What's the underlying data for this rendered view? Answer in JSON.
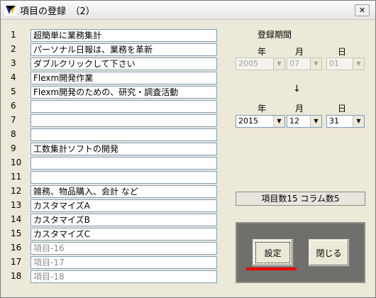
{
  "window": {
    "title": "項目の登録　（2）",
    "close_icon": "close-icon",
    "app_icon": "app-icon"
  },
  "rows": [
    {
      "num": "1",
      "text": "超簡単に業務集計",
      "placeholder": false
    },
    {
      "num": "2",
      "text": "パーソナル日報は、業務を革新",
      "placeholder": false
    },
    {
      "num": "3",
      "text": "ダブルクリックして下さい",
      "placeholder": false
    },
    {
      "num": "4",
      "text": "Flexm開発作業",
      "placeholder": false
    },
    {
      "num": "5",
      "text": "Flexm開発のための、研究・調査活動",
      "placeholder": false
    },
    {
      "num": "6",
      "text": "",
      "placeholder": false
    },
    {
      "num": "7",
      "text": "",
      "placeholder": false
    },
    {
      "num": "8",
      "text": "",
      "placeholder": false
    },
    {
      "num": "9",
      "text": "工数集計ソフトの開発",
      "placeholder": false
    },
    {
      "num": "10",
      "text": "",
      "placeholder": false
    },
    {
      "num": "11",
      "text": "",
      "placeholder": false
    },
    {
      "num": "12",
      "text": "雑務、物品購入、会計 など",
      "placeholder": false
    },
    {
      "num": "13",
      "text": "カスタマイズA",
      "placeholder": false
    },
    {
      "num": "14",
      "text": "カスタマイズB",
      "placeholder": false
    },
    {
      "num": "15",
      "text": "カスタマイズC",
      "placeholder": false
    },
    {
      "num": "16",
      "text": "項目-16",
      "placeholder": true
    },
    {
      "num": "17",
      "text": "項目-17",
      "placeholder": true
    },
    {
      "num": "18",
      "text": "項目-18",
      "placeholder": true
    }
  ],
  "period": {
    "title": "登録期間",
    "year_label": "年",
    "month_label": "月",
    "day_label": "日",
    "arrow": "↓",
    "from": {
      "year": "2005",
      "month": "07",
      "day": "01"
    },
    "to": {
      "year": "2015",
      "month": "12",
      "day": "31"
    }
  },
  "status": "項目数15  コラム数5",
  "buttons": {
    "set": "設定",
    "close": "閉じる"
  },
  "colors": {
    "highlight": "#ee0000",
    "panel": "#6f706b"
  }
}
